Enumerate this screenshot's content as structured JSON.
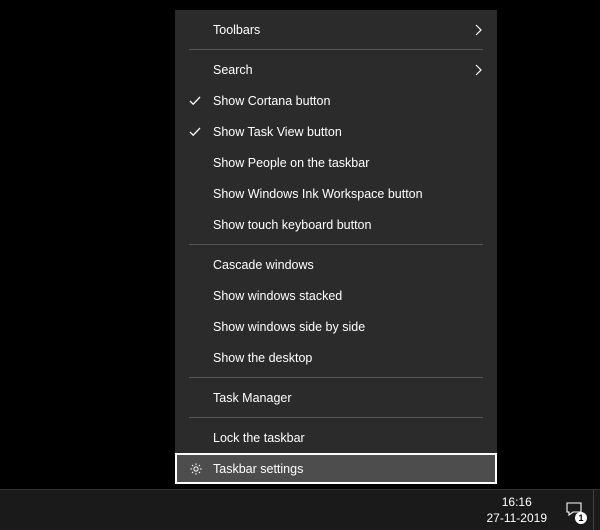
{
  "menu": {
    "group1": [
      {
        "label": "Toolbars",
        "submenu": true
      }
    ],
    "group2": [
      {
        "label": "Search",
        "submenu": true
      },
      {
        "label": "Show Cortana button",
        "checked": true
      },
      {
        "label": "Show Task View button",
        "checked": true
      },
      {
        "label": "Show People on the taskbar"
      },
      {
        "label": "Show Windows Ink Workspace button"
      },
      {
        "label": "Show touch keyboard button"
      }
    ],
    "group3": [
      {
        "label": "Cascade windows"
      },
      {
        "label": "Show windows stacked"
      },
      {
        "label": "Show windows side by side"
      },
      {
        "label": "Show the desktop"
      }
    ],
    "group4": [
      {
        "label": "Task Manager"
      }
    ],
    "group5": [
      {
        "label": "Lock the taskbar"
      },
      {
        "label": "Taskbar settings",
        "icon": "gear",
        "highlight": true
      }
    ]
  },
  "tray": {
    "time": "16:16",
    "date": "27-11-2019",
    "action_center_count": "1"
  }
}
